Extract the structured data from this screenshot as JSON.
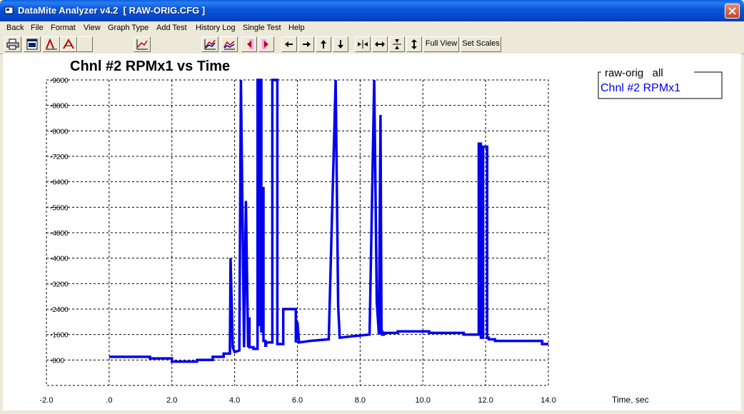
{
  "window": {
    "title": "DataMite Analyzer v4.2  [ RAW-ORIG.CFG ]"
  },
  "menu": [
    "Back",
    "File",
    "Format",
    "View",
    "Graph Type",
    "Add Test",
    "History Log",
    "Single Test",
    "Help"
  ],
  "toolbar": {
    "full_view_label": "Full View",
    "set_scales_label": "Set Scales"
  },
  "chart_data": {
    "type": "line",
    "title": "Chnl #2 RPMx1 vs Time",
    "xlabel": "Time, sec",
    "ylabel": "",
    "xlim": [
      -2.0,
      14.0
    ],
    "ylim": [
      0,
      9600
    ],
    "x_ticks": [
      "-2.0",
      ".0",
      "2.0",
      "4.0",
      "6.0",
      "8.0",
      "10.0",
      "12.0",
      "14.0"
    ],
    "y_ticks": [
      "-800",
      "-1600",
      "-2400",
      "-3200",
      "-4000",
      "-4800",
      "-5600",
      "-6400",
      "-7200",
      "-8000",
      "-8800",
      "-9600"
    ],
    "grid": true,
    "legend": {
      "header": "raw-orig   all",
      "position": "top-right"
    },
    "series": [
      {
        "name": "Chnl #2 RPMx1",
        "color": "#0000EE",
        "x": [
          0.0,
          1.3,
          1.3,
          2.0,
          2.0,
          2.8,
          2.8,
          3.3,
          3.3,
          3.65,
          3.65,
          3.85,
          3.85,
          3.87,
          3.87,
          3.94,
          3.94,
          4.0,
          4.0,
          4.15,
          4.15,
          4.2,
          4.2,
          4.3,
          4.3,
          4.36,
          4.36,
          4.43,
          4.43,
          4.47,
          4.47,
          4.6,
          4.6,
          4.73,
          4.73,
          4.8,
          4.8,
          4.83,
          4.83,
          4.85,
          4.85,
          4.9,
          4.9,
          4.92,
          4.92,
          4.98,
          4.98,
          5.0,
          5.0,
          5.2,
          5.2,
          5.36,
          5.36,
          5.42,
          5.42,
          5.55,
          5.55,
          5.95,
          5.95,
          6.0,
          6.0,
          6.05,
          6.05,
          6.4,
          6.4,
          7.0,
          7.0,
          7.22,
          7.22,
          7.3,
          7.3,
          7.35,
          7.35,
          7.8,
          7.8,
          8.3,
          8.3,
          8.45,
          8.45,
          8.53,
          8.53,
          8.6,
          8.6,
          8.65,
          8.65,
          8.68,
          8.68,
          8.7,
          8.7,
          8.75,
          8.75,
          9.2,
          9.2,
          10.2,
          10.2,
          11.3,
          11.3,
          11.78,
          11.78,
          11.85,
          11.85,
          11.92,
          11.92,
          12.05,
          12.05,
          12.1,
          12.1,
          12.3,
          12.3,
          13.8,
          13.8,
          14.0
        ],
        "y": [
          900,
          900,
          850,
          850,
          750,
          750,
          800,
          800,
          900,
          900,
          1000,
          1000,
          1200,
          4000,
          4000,
          1200,
          1200,
          1050,
          1050,
          1100,
          1100,
          9600,
          9600,
          1200,
          1200,
          5800,
          5800,
          1200,
          2100,
          2100,
          1200,
          1200,
          1150,
          1150,
          9600,
          9600,
          1900,
          1900,
          9600,
          9600,
          1700,
          1700,
          6200,
          6200,
          1400,
          1400,
          1250,
          1250,
          1350,
          1350,
          9600,
          9600,
          1300,
          1300,
          1300,
          1300,
          2400,
          2400,
          1350,
          2000,
          2000,
          1350,
          1350,
          1400,
          1400,
          1450,
          1450,
          9600,
          9600,
          2500,
          2500,
          1500,
          1500,
          1550,
          1550,
          1600,
          1600,
          9600,
          9600,
          2600,
          2600,
          1600,
          1600,
          8500,
          8500,
          1600,
          1700,
          1700,
          1600,
          1600,
          1650,
          1650,
          1700,
          1700,
          1650,
          1650,
          1600,
          1600,
          7600,
          7600,
          1500,
          1500,
          7500,
          7500,
          1500,
          1500,
          1450,
          1450,
          1400,
          1400,
          1300,
          1300
        ]
      }
    ]
  }
}
